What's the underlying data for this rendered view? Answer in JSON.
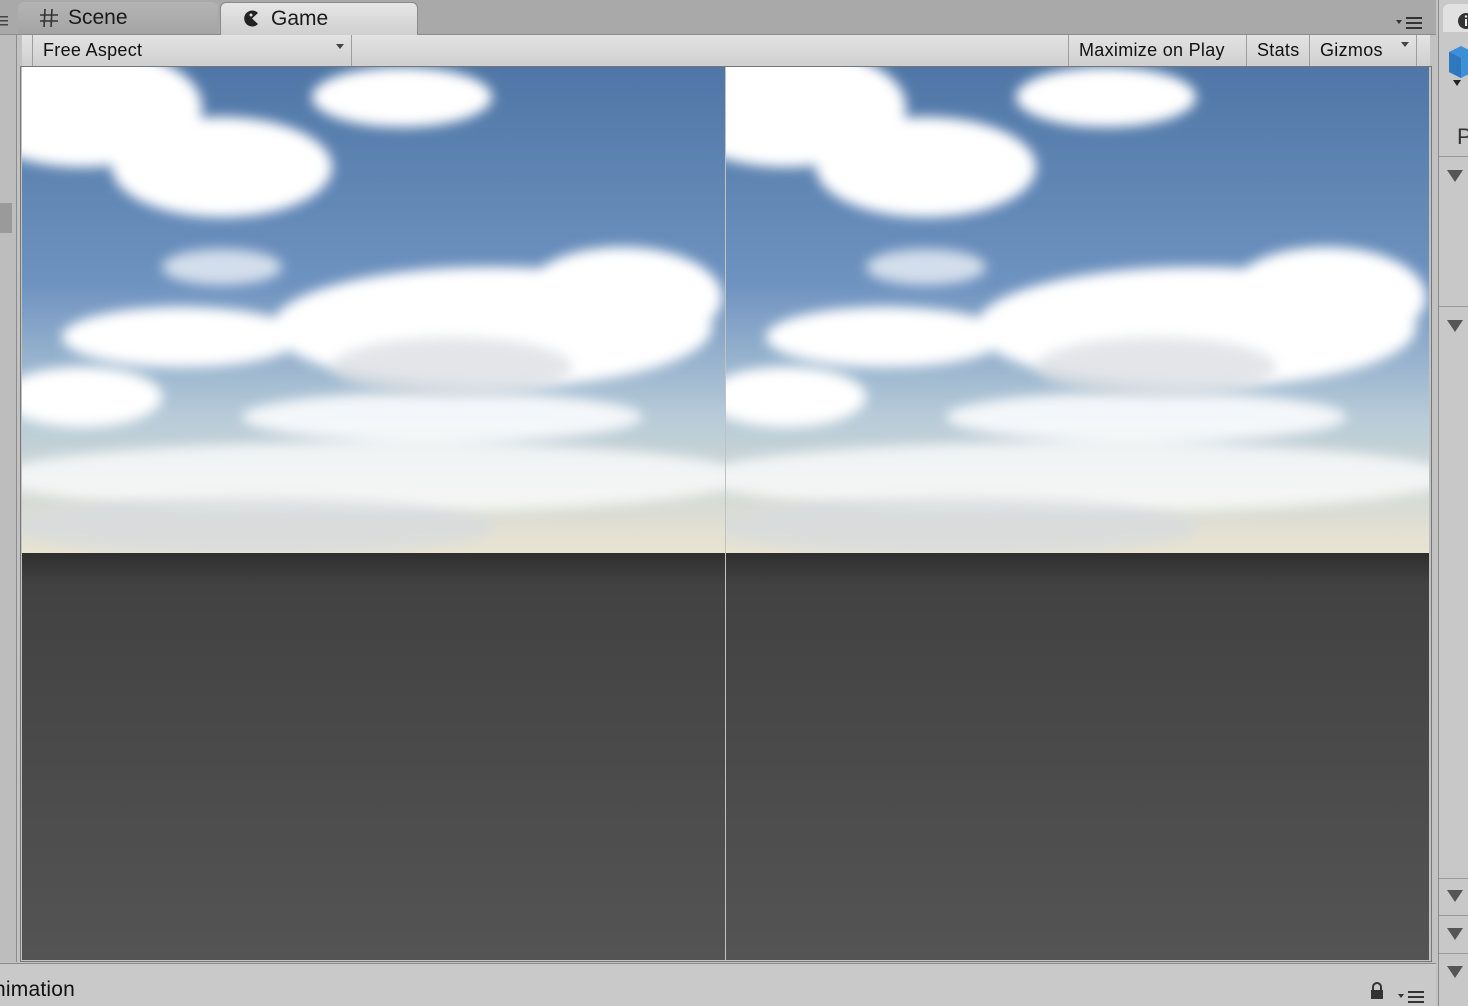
{
  "tabs": {
    "scene_label": "Scene",
    "game_label": "Game",
    "active": "Game"
  },
  "toolbar": {
    "aspect_label": "Free Aspect",
    "maximize_label": "Maximize on Play",
    "stats_label": "Stats",
    "gizmos_label": "Gizmos"
  },
  "viewports": {
    "layout": "side-by-side stereo",
    "sky_colors": {
      "sky_top": "#4f76a6",
      "sky_mid": "#6f93c0",
      "horizon": "#e9e4d2",
      "cloud": "#ffffff",
      "ground_dark": "#3c3c3c",
      "ground_light": "#545454"
    }
  },
  "inspector": {
    "partial_label": "P",
    "info_icon": "info-icon",
    "cube_icon": "prefab-cube-icon"
  },
  "bottom_panel": {
    "title": "nimation"
  },
  "icons": {
    "scene_tab": "grid-hash-icon",
    "game_tab": "pacman-icon",
    "panel_menu": "panel-menu-icon",
    "lock": "lock-icon"
  }
}
